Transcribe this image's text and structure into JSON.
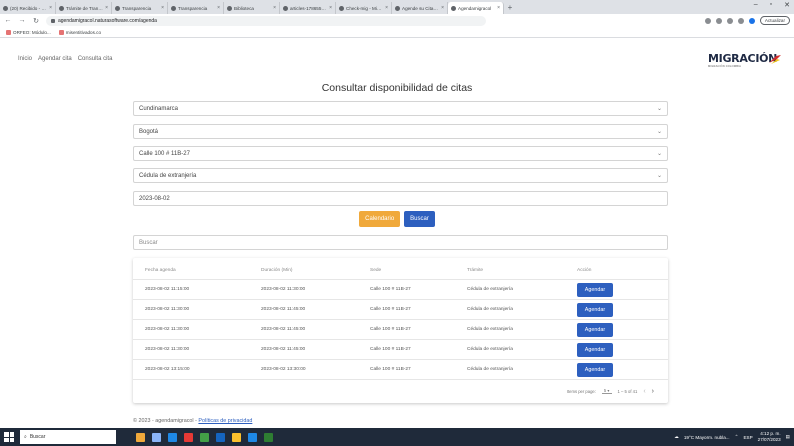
{
  "browser": {
    "tabs": [
      {
        "label": "(20) Recibido - crsm",
        "active": false
      },
      {
        "label": "Trámite de Transparenc",
        "active": false
      },
      {
        "label": "Transparencia",
        "active": false
      },
      {
        "label": "Transparencia",
        "active": false
      },
      {
        "label": "Biblioteca",
        "active": false
      },
      {
        "label": "articles-178655_Direct",
        "active": false
      },
      {
        "label": "Check-mig - Migraci",
        "active": false
      },
      {
        "label": "Agende su Cita - UNI",
        "active": false
      },
      {
        "label": "Agendamigracol",
        "active": true
      }
    ],
    "url": "agendamigracol.naturasoftware.com/agenda",
    "update_label": "Actualizar",
    "bookmarks": [
      "ORFEO: Módulo...",
      "misentitivados.co"
    ]
  },
  "nav": {
    "items": [
      "Inicio",
      "Agendar cita",
      "Consulta cita"
    ]
  },
  "brand": {
    "name": "MIGRACIÓN",
    "subtitle": "MIGRACIÓN COLOMBIA",
    "colors": {
      "navy": "#1f2a44",
      "red": "#d32f2f",
      "yellow": "#f5c518"
    }
  },
  "form": {
    "title": "Consultar disponibilidad de citas",
    "department": "Cundinamarca",
    "city": "Bogotá",
    "office": "Calle 100 # 11B-27",
    "document_type": "Cédula de extranjería",
    "date": "2023-08-02",
    "calendar_label": "Calendario",
    "search_label": "Buscar",
    "filter_placeholder": "Buscar"
  },
  "table": {
    "headers": [
      "Fecha agenda",
      "Duración (Min)",
      "Sede",
      "Trámite",
      "Acción"
    ],
    "rows": [
      {
        "fecha": "2023-08-02 11:15:00",
        "duracion": "2023-08-02 11:30:00",
        "sede": "Calle 100 # 11B-27",
        "tramite": "Cédula de extranjería",
        "accion": "Agendar"
      },
      {
        "fecha": "2023-08-02 11:30:00",
        "duracion": "2023-08-02 11:45:00",
        "sede": "Calle 100 # 11B-27",
        "tramite": "Cédula de extranjería",
        "accion": "Agendar"
      },
      {
        "fecha": "2023-08-02 11:30:00",
        "duracion": "2023-08-02 11:45:00",
        "sede": "Calle 100 # 11B-27",
        "tramite": "Cédula de extranjería",
        "accion": "Agendar"
      },
      {
        "fecha": "2023-08-02 11:30:00",
        "duracion": "2023-08-02 11:45:00",
        "sede": "Calle 100 # 11B-27",
        "tramite": "Cédula de extranjería",
        "accion": "Agendar"
      },
      {
        "fecha": "2023-08-02 13:15:00",
        "duracion": "2023-08-02 13:30:00",
        "sede": "Calle 100 # 11B-27",
        "tramite": "Cédula de extranjería",
        "accion": "Agendar"
      }
    ],
    "items_per_page_label": "Items per page:",
    "items_per_page": "5",
    "range": "1 – 5 of 41"
  },
  "footer": {
    "copyright": "© 2023 - agendamigracol -",
    "privacy_link": "Políticas de privacidad"
  },
  "taskbar": {
    "search_placeholder": "Buscar",
    "weather": "19°C Mayorm. nubla...",
    "language": "ESP",
    "time": "4:12 p. m.",
    "date": "27/07/2023",
    "app_colors": [
      "#f0a93b",
      "#8ab4f8",
      "#1e88e5",
      "#e53935",
      "#43a047",
      "#1565c0",
      "#fbc02d",
      "#1e88e5",
      "#2e7d32"
    ]
  },
  "colors": {
    "primary_button": "#2d5fbf",
    "calendar_button": "#f0a93b"
  }
}
